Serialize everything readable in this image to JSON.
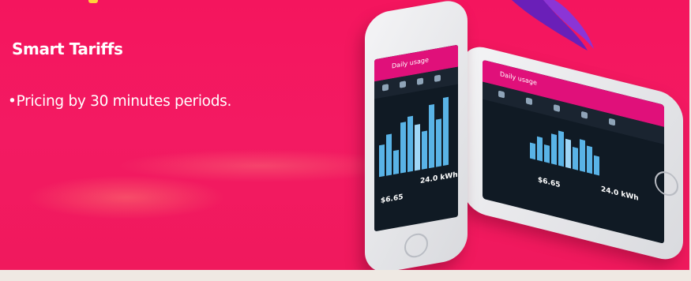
{
  "slide": {
    "title": "Smart Tariffs",
    "bullet": "•Pricing by 30 minutes periods."
  },
  "phone_front": {
    "app_title": "Daily usage",
    "usage": "24.0 kWh",
    "cost": "$6.65"
  },
  "phone_back": {
    "app_title": "Daily usage",
    "usage": "24.0 kWh",
    "cost": "$6.65"
  },
  "colors": {
    "background": "#f31a62",
    "app_bar": "#e0107a",
    "chart_bar": "#59b3e6"
  }
}
